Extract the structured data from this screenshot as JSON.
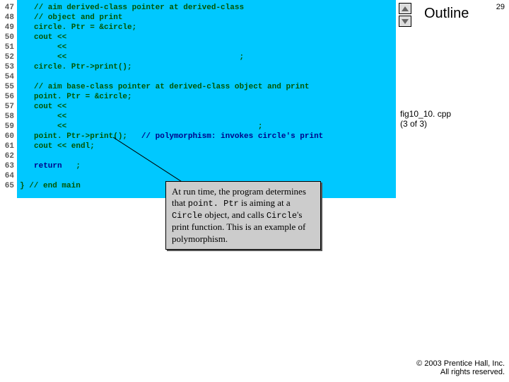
{
  "slideNumber": "29",
  "outlineLabel": "Outline",
  "fileCaption": {
    "name": "fig10_10. cpp",
    "part": "(3 of 3)"
  },
  "copyright": {
    "line1": "© 2003 Prentice Hall, Inc.",
    "line2": "All rights reserved."
  },
  "gutter": [
    "47",
    "48",
    "49",
    "50",
    "51",
    "52",
    "53",
    "54",
    "55",
    "56",
    "57",
    "58",
    "59",
    "60",
    "61",
    "62",
    "63",
    "64",
    "65"
  ],
  "code": {
    "l47": "// aim derived-class pointer at derived-class",
    "l48": "// object and print",
    "l49": "circle. Ptr = &circle;",
    "l50": "cout << ",
    "l51": "     << ",
    "l52": "     <<                                     ;",
    "l53": "circle. Ptr->print();",
    "l54": "",
    "l55": "// aim base-class pointer at derived-class object and print",
    "l56": "point. Ptr = &circle;",
    "l57": "cout << ",
    "l58": "     << ",
    "l59": "     <<                                         ;",
    "l60a": "point. Ptr->print();   ",
    "l60b": "// polymorphism: invokes circle's print",
    "l61": "cout << endl;",
    "l62": "",
    "l63a": "return",
    "l63b": "   ;",
    "l64": "",
    "l65": "} // end main"
  },
  "callout": {
    "t1": "At run time, the program determines that ",
    "m1": "point. Ptr",
    "t2": " is aiming at a ",
    "m2": "Circle",
    "t3": " object, and calls ",
    "m3": "Circle",
    "t4": "'s print function. This is an example of polymorphism."
  }
}
